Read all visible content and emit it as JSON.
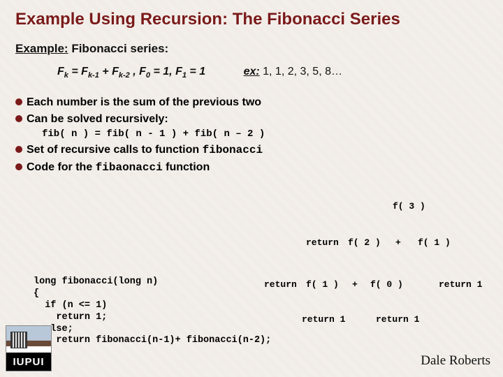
{
  "title": "Example Using Recursion: The Fibonacci Series",
  "example": {
    "label": "Example:",
    "text": "Fibonacci series:"
  },
  "formula": {
    "lhs_var": "F",
    "lhs_sub": "k",
    "eq1": "= ",
    "t1_var": "F",
    "t1_sub": "k-1",
    "plus": " + ",
    "t2_var": "F",
    "t2_sub": "k-2",
    "comma": ",   ",
    "b0_var": "F",
    "b0_sub": "0",
    "b0_rhs": " = 1, ",
    "b1_var": "F",
    "b1_sub": "1",
    "b1_rhs": " = 1",
    "ex_label": "ex:",
    "ex_vals": " 1, 1, 2, 3, 5, 8…"
  },
  "bullets": {
    "b1": "Each number is the sum of the previous two",
    "b2": "Can be solved recursively:",
    "code1": "fib( n ) = fib( n - 1 ) + fib( n – 2 )",
    "b3_pre": "Set of recursive calls to function ",
    "b3_mono": "fibonacci",
    "b4_pre": "Code for the ",
    "b4_mono": "fibaonacci",
    "b4_post": " function"
  },
  "tree": {
    "n1": "f( 3 )",
    "n2a": "return",
    "n2b": "f( 2 )",
    "n2c": "+",
    "n2d": "f( 1 )",
    "n3a": "return",
    "n3b": "f( 1 )",
    "n3c": "+",
    "n3d": "f( 0 )",
    "n3e": "return 1",
    "n4a": "return 1",
    "n4b": "return 1"
  },
  "code": "long fibonacci(long n)\n{\n  if (n <= 1)\n    return 1;\n  else;\n    return fibonacci(n-1)+ fibonacci(n-2);\n}",
  "logo_text": "IUPUI",
  "author": "Dale Roberts"
}
